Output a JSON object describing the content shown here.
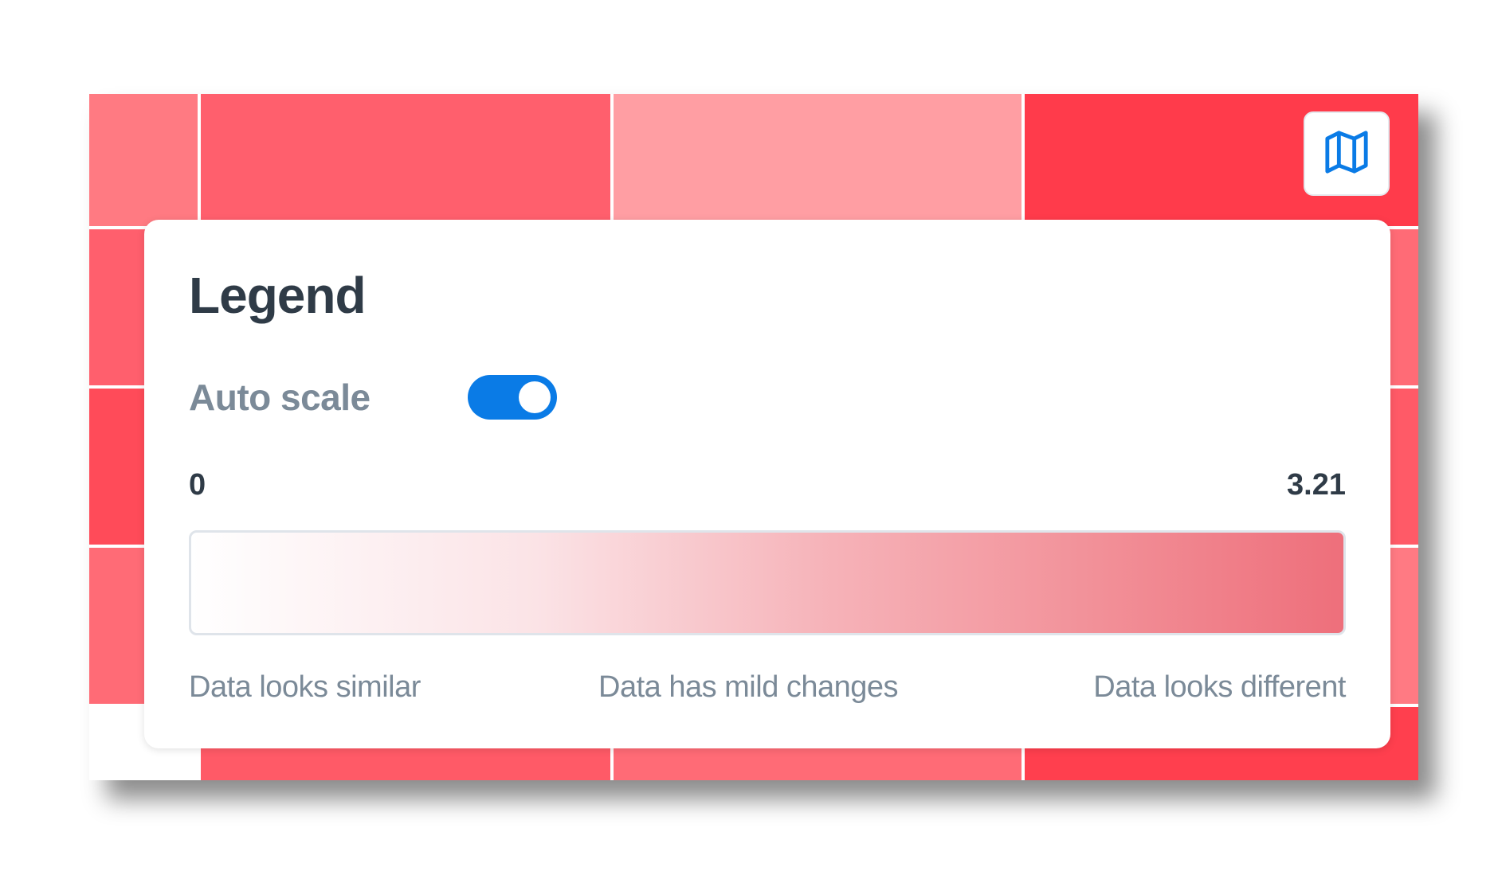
{
  "legend": {
    "title": "Legend",
    "auto_scale_label": "Auto scale",
    "auto_scale_enabled": true,
    "scale_min": "0",
    "scale_max": "3.21",
    "descriptions": {
      "low": "Data looks similar",
      "mid": "Data has mild changes",
      "high": "Data looks different"
    }
  },
  "map_button": {
    "icon": "map-icon"
  },
  "colors": {
    "toggle_on": "#0a7be6",
    "map_icon": "#0a7be6",
    "heat_low": "#ffffff",
    "heat_high": "#ee6f7b"
  }
}
